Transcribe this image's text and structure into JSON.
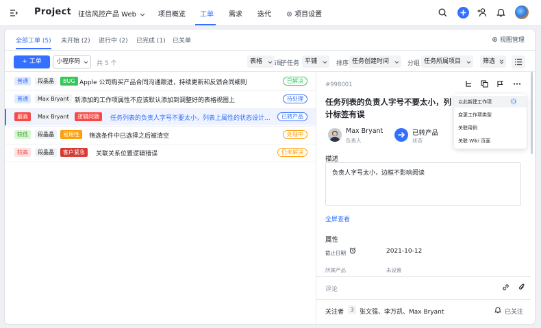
{
  "app": {
    "title": "Project",
    "project_menu": "征信风控产品 Web",
    "nav": [
      {
        "label": "项目概览",
        "active": false
      },
      {
        "label": "工单",
        "active": true
      },
      {
        "label": "需求",
        "active": false
      },
      {
        "label": "迭代",
        "active": false
      }
    ],
    "settings_label": "项目设置"
  },
  "tabs": [
    {
      "label": "全部工单 (5)",
      "active": true
    },
    {
      "label": "未开始 (2)"
    },
    {
      "label": "进行中 (2)"
    },
    {
      "label": "已完成 (1)"
    },
    {
      "label": "已关单"
    }
  ],
  "view_manage": "视图管理",
  "toolbar": {
    "new_label": "+ 工单",
    "program_select": "小程序码",
    "count_text": "共 5 个",
    "layout_label": "布局",
    "layout_value": "表格",
    "subtask_label": "子任务",
    "subtask_value": "平铺",
    "sort_label": "排序",
    "sort_value": "任务创建时间",
    "group_label": "分组",
    "group_value": "任务所属项目",
    "filter_label": "筛选"
  },
  "rows": [
    {
      "priority": "普通",
      "pcolor": "#3370ff",
      "pbg": "#e1eaff",
      "assignee": "段晶晶",
      "type": "BUG",
      "tcolor": "#ffffff",
      "tbg": "#34c759",
      "title": "Apple 公司购买产品合同沟通跟进，持续更新和反馈合同细则",
      "status": "已解决",
      "scolor": "#34c759",
      "selected": false
    },
    {
      "priority": "普通",
      "pcolor": "#3370ff",
      "pbg": "#e1eaff",
      "assignee": "Max Bryant",
      "type": "",
      "tcolor": "",
      "tbg": "",
      "title": "新添加的工作项属性不应该默认添加到调整好的表格视图上",
      "status": "待处理",
      "scolor": "#3370ff",
      "selected": false
    },
    {
      "priority": "最高",
      "pcolor": "#ffffff",
      "pbg": "#f54a45",
      "assignee": "Max Bryant",
      "type": "逻辑问题",
      "tcolor": "#ffffff",
      "tbg": "#f54a45",
      "title": "任务列表的负责人字号不要太小，列表上属性的状态设计...",
      "status": "已转产品",
      "scolor": "#3370ff",
      "selected": true
    },
    {
      "priority": "较低",
      "pcolor": "#2ea121",
      "pbg": "#d9f5d6",
      "assignee": "段晶晶",
      "type": "易用性",
      "tcolor": "#ffffff",
      "tbg": "#ff9f0a",
      "title": "筛选条件中已选择之后被清空",
      "status": "处理中",
      "scolor": "#ff9f0a",
      "selected": false
    },
    {
      "priority": "较高",
      "pcolor": "#f54a45",
      "pbg": "#fde2e2",
      "assignee": "段晶晶",
      "type": "客户紧急",
      "tcolor": "#ffffff",
      "tbg": "#d83931",
      "title": "关联关系位置逻辑错误",
      "status": "仍未解决",
      "scolor": "#ff9f0a",
      "selected": false
    }
  ],
  "detail": {
    "id": "#998001",
    "title_line1": "任务列表的负责人字号不要太小，列",
    "title_line2": "计标签有误",
    "assignee_name": "Max Bryant",
    "assignee_role": "负责人",
    "status_name": "已转产品",
    "status_role": "状态",
    "desc_label": "描述",
    "desc_text": "负责人字号太小，边框不影响阅读",
    "fullscreen": "全屏查看",
    "attr_label": "属性",
    "due_label": "截止日期",
    "due_value": "2021-10-12",
    "product_label": "所属产品",
    "product_value": "未设置",
    "comment_placeholder": "评论",
    "followers_label": "关注者",
    "followers_count": "3",
    "followers_names": "张文强、李万凯、Max Bryant",
    "followed_label": "已关注"
  },
  "menu": [
    "以此新建工作项",
    "变更工作项类型",
    "关联用例",
    "关联 Wiki 页面"
  ],
  "colors": {
    "accent": "#3370ff",
    "text": "#1f2329",
    "muted": "#86909c"
  }
}
